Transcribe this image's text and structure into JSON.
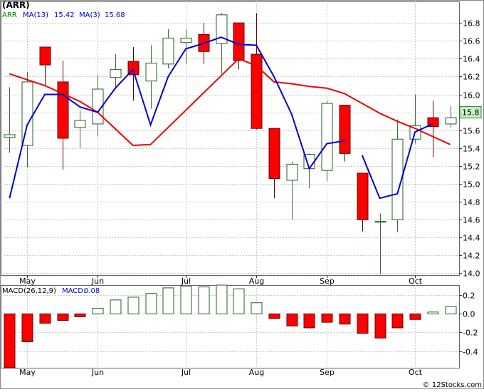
{
  "chart_data": [
    {
      "type": "candlestick",
      "title": "(ARR)",
      "legend": [
        {
          "label": "ARR",
          "color": "#008000"
        },
        {
          "label": "MA(13)",
          "value": "15.42",
          "color": "#ff0000"
        },
        {
          "label": "MA(3)",
          "value": "15.68",
          "color": "#0000cc"
        }
      ],
      "x_ticks": [
        {
          "label": "May",
          "index": 1
        },
        {
          "label": "Jun",
          "index": 5
        },
        {
          "label": "Jul",
          "index": 10
        },
        {
          "label": "Aug",
          "index": 14
        },
        {
          "label": "Sep",
          "index": 18
        },
        {
          "label": "Oct",
          "index": 23
        }
      ],
      "y_ticks": [
        "14.0",
        "14.2",
        "14.4",
        "14.6",
        "14.8",
        "15.0",
        "15.2",
        "15.4",
        "15.6",
        "15.8",
        "16.0",
        "16.2",
        "16.4",
        "16.6",
        "16.8"
      ],
      "ylim": [
        13.98,
        17.04
      ],
      "last_price": "15.8",
      "candles": [
        {
          "o": 15.52,
          "h": 16.08,
          "l": 15.35,
          "c": 15.55
        },
        {
          "o": 15.43,
          "h": 16.25,
          "l": 15.19,
          "c": 16.14
        },
        {
          "o": 16.53,
          "h": 16.53,
          "l": 16.1,
          "c": 16.33
        },
        {
          "o": 16.14,
          "h": 16.38,
          "l": 15.16,
          "c": 15.51
        },
        {
          "o": 15.63,
          "h": 15.82,
          "l": 15.4,
          "c": 15.71
        },
        {
          "o": 15.67,
          "h": 16.22,
          "l": 15.53,
          "c": 16.06
        },
        {
          "o": 16.19,
          "h": 16.45,
          "l": 16.06,
          "c": 16.28
        },
        {
          "o": 16.37,
          "h": 16.53,
          "l": 15.93,
          "c": 16.22
        },
        {
          "o": 16.15,
          "h": 16.55,
          "l": 15.84,
          "c": 16.35
        },
        {
          "o": 16.34,
          "h": 16.73,
          "l": 16.29,
          "c": 16.63
        },
        {
          "o": 16.58,
          "h": 16.73,
          "l": 16.34,
          "c": 16.63
        },
        {
          "o": 16.67,
          "h": 16.8,
          "l": 16.34,
          "c": 16.48
        },
        {
          "o": 16.57,
          "h": 16.91,
          "l": 16.23,
          "c": 16.89
        },
        {
          "o": 16.8,
          "h": 16.8,
          "l": 16.28,
          "c": 16.38
        },
        {
          "o": 16.45,
          "h": 16.91,
          "l": 15.61,
          "c": 15.62
        },
        {
          "o": 15.62,
          "h": 15.62,
          "l": 14.84,
          "c": 15.06
        },
        {
          "o": 15.04,
          "h": 15.25,
          "l": 14.6,
          "c": 15.22
        },
        {
          "o": 15.17,
          "h": 15.34,
          "l": 14.95,
          "c": 15.33
        },
        {
          "o": 15.15,
          "h": 15.93,
          "l": 15.03,
          "c": 15.9
        },
        {
          "o": 15.88,
          "h": 15.88,
          "l": 15.25,
          "c": 15.34
        },
        {
          "o": 15.12,
          "h": 15.12,
          "l": 14.47,
          "c": 14.6
        },
        {
          "o": 14.58,
          "h": 14.67,
          "l": 13.99,
          "c": 14.58
        },
        {
          "o": 14.6,
          "h": 15.72,
          "l": 14.46,
          "c": 15.5
        },
        {
          "o": 15.5,
          "h": 16.0,
          "l": 15.45,
          "c": 15.65
        },
        {
          "o": 15.74,
          "h": 15.93,
          "l": 15.3,
          "c": 15.64
        },
        {
          "o": 15.67,
          "h": 15.87,
          "l": 15.63,
          "c": 15.74
        }
      ],
      "ma13": [
        {
          "i": 0,
          "v": 16.23
        },
        {
          "i": 2,
          "v": 16.1
        },
        {
          "i": 4,
          "v": 15.92
        },
        {
          "i": 5,
          "v": 15.8
        },
        {
          "i": 7,
          "v": 15.43
        },
        {
          "i": 8,
          "v": 15.44
        },
        {
          "i": 13,
          "v": 16.4
        },
        {
          "i": 14,
          "v": 16.32
        },
        {
          "i": 15,
          "v": 16.14
        },
        {
          "i": 16,
          "v": 16.12
        },
        {
          "i": 17,
          "v": 16.09
        },
        {
          "i": 18,
          "v": 16.07
        },
        {
          "i": 19,
          "v": 16.01
        },
        {
          "i": 20,
          "v": 15.9
        },
        {
          "i": 21,
          "v": 15.79
        },
        {
          "i": 22,
          "v": 15.7
        },
        {
          "i": 23,
          "v": 15.62
        },
        {
          "i": 24,
          "v": 15.53
        },
        {
          "i": 25,
          "v": 15.44
        }
      ],
      "ma13_gaps": [
        [
          5,
          7
        ]
      ],
      "ma3_break_after": [
        19,
        25
      ],
      "ma3": [
        {
          "i": 0,
          "v": 14.84
        },
        {
          "i": 1,
          "v": 15.66
        },
        {
          "i": 2,
          "v": 16.0
        },
        {
          "i": 3,
          "v": 16.0
        },
        {
          "i": 4,
          "v": 15.86
        },
        {
          "i": 5,
          "v": 15.8
        },
        {
          "i": 6,
          "v": 16.07
        },
        {
          "i": 7,
          "v": 16.28
        },
        {
          "i": 8,
          "v": 15.66
        },
        {
          "i": 9,
          "v": 16.2
        },
        {
          "i": 10,
          "v": 16.51
        },
        {
          "i": 11,
          "v": 16.57
        },
        {
          "i": 12,
          "v": 16.64
        },
        {
          "i": 13,
          "v": 16.56
        },
        {
          "i": 14,
          "v": 16.55
        },
        {
          "i": 15,
          "v": 16.2
        },
        {
          "i": 16,
          "v": 15.78
        },
        {
          "i": 17,
          "v": 15.17
        },
        {
          "i": 18,
          "v": 15.45
        },
        {
          "i": 19,
          "v": 15.48
        },
        {
          "i": 20,
          "v": 15.32
        },
        {
          "i": 21,
          "v": 14.84
        },
        {
          "i": 22,
          "v": 14.89
        },
        {
          "i": 23,
          "v": 15.58
        },
        {
          "i": 24,
          "v": 15.67
        }
      ]
    },
    {
      "type": "bar",
      "title": "MACD(26,12,9)",
      "legend": [
        {
          "label": "MACD(26,12,9)",
          "color": "#000000"
        },
        {
          "label": "MACD:",
          "value": "0.08",
          "color": "#0000cc"
        }
      ],
      "x_ticks": [
        "May",
        "Jun",
        "Jul",
        "Aug",
        "Sep",
        "Oct"
      ],
      "y_ticks": [
        "0.2",
        "0.0",
        "-0.2",
        "-0.4"
      ],
      "ylim": [
        -0.58,
        0.31
      ],
      "values": [
        -0.58,
        -0.3,
        -0.1,
        -0.07,
        -0.03,
        0.06,
        0.15,
        0.18,
        0.22,
        0.28,
        0.3,
        0.29,
        0.31,
        0.27,
        0.12,
        -0.05,
        -0.13,
        -0.15,
        -0.09,
        -0.11,
        -0.21,
        -0.26,
        -0.15,
        -0.06,
        0.02,
        0.08
      ]
    }
  ],
  "footer": {
    "copyright": "© 12Stocks.com"
  }
}
